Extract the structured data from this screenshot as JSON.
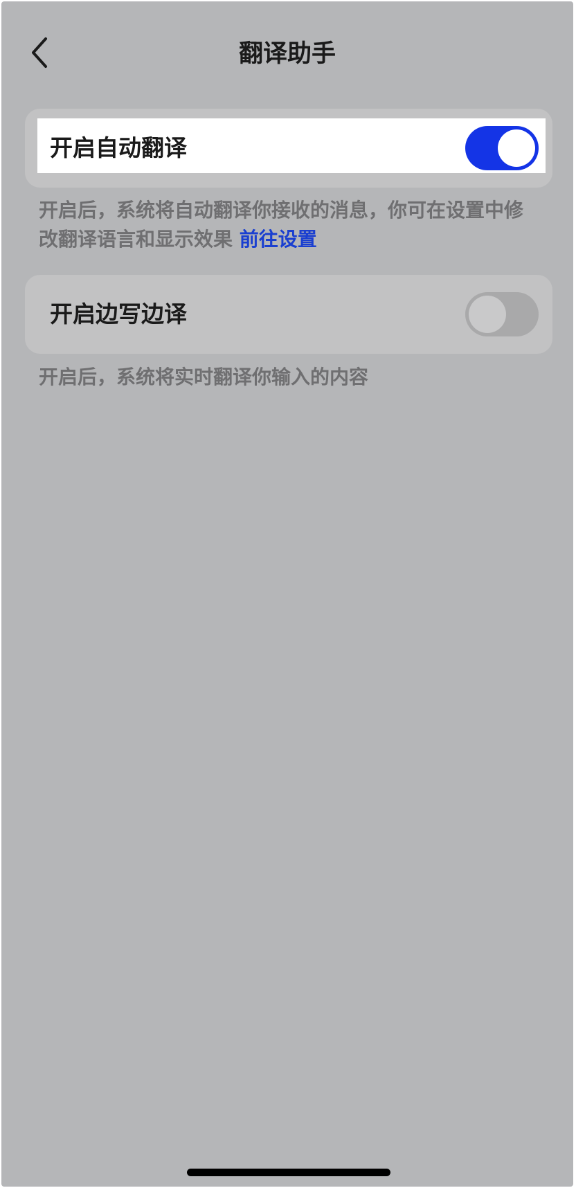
{
  "header": {
    "title": "翻译助手",
    "back_icon": "chevron-left-icon"
  },
  "settings": {
    "auto_translate": {
      "label": "开启自动翻译",
      "enabled": true,
      "description": "开启后，系统将自动翻译你接收的消息，你可在设置中修改翻译语言和显示效果",
      "link_label": "前往设置"
    },
    "write_translate": {
      "label": "开启边写边译",
      "enabled": false,
      "description": "开启后，系统将实时翻译你输入的内容"
    }
  },
  "colors": {
    "background": "#b5b6b8",
    "card": "#c2c2c3",
    "toggle_on": "#1434e6",
    "toggle_off": "#a9a9aa",
    "link": "#1a3fd0",
    "description_text": "#6f6f71"
  }
}
